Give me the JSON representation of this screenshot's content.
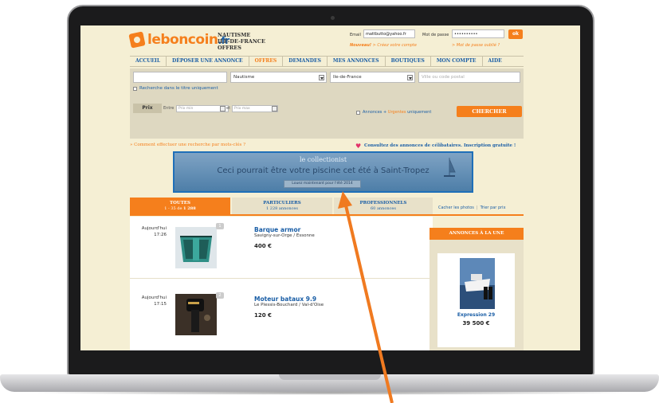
{
  "colors": {
    "brand_orange": "#f57f1c",
    "link_blue": "#1a5ea6",
    "page_bg": "#f5efd4",
    "annotation_arrow": "#f07a20"
  },
  "header": {
    "logo_text": "leboncoin",
    "logo_tld": ".fr",
    "breadcrumb": [
      "NAUTISME",
      "ILE-DE-FRANCE",
      "OFFRES"
    ]
  },
  "login": {
    "email_label": "Email",
    "email_value": "mattbutto@yahoo.fr",
    "password_label": "Mot de passe",
    "password_value": "••••••••••",
    "ok_label": "ok",
    "new_label": "Nouveau!",
    "create_account": "> Créez votre compte",
    "forgot_password": "> Mot de passe oublié ?"
  },
  "nav": {
    "items": [
      "ACCUEIL",
      "DÉPOSER UNE ANNONCE",
      "OFFRES",
      "DEMANDES",
      "MES ANNONCES",
      "BOUTIQUES",
      "MON COMPTE",
      "AIDE"
    ]
  },
  "search": {
    "query_value": "",
    "category_value": "Nautisme",
    "region_value": "Ile-de-France",
    "city_placeholder": "Ville ou code postal",
    "title_only_label": "Recherche dans le titre uniquement",
    "price_label": "Prix",
    "between_label": "Entre",
    "price_min": "Prix min",
    "and_label": "et",
    "price_max": "Prix max",
    "annonces_label": "Annonces",
    "urgentes_label": "Urgentes",
    "uniquement_label": "uniquement",
    "submit_label": "CHERCHER"
  },
  "links": {
    "howto": "» Comment effectuer une recherche par mots-clés ?",
    "celibataires": "Consultez des annonces de célibataires. Inscription gratuite !"
  },
  "banner": {
    "title": "le collectionist",
    "headline": "Ceci pourrait être votre piscine cet été à Saint-Tropez",
    "button": "Louez maintenant pour l'été 2014"
  },
  "tabs": [
    {
      "label": "TOUTES",
      "sub_prefix": "1 - 35 de",
      "sub_count": "1 288"
    },
    {
      "label": "PARTICULIERS",
      "sub": "1 228 annonces"
    },
    {
      "label": "PROFESSIONNELS",
      "sub": "60 annonces"
    }
  ],
  "tab_links": {
    "hide_photos": "Cacher les photos",
    "sort_price": "Trier par prix"
  },
  "listings": [
    {
      "date": "Aujourd'hui",
      "time": "17:26",
      "title": "Barque armor",
      "location": "Savigny-sur-Orge / Essonne",
      "price": "400 €",
      "photos": "1"
    },
    {
      "date": "Aujourd'hui",
      "time": "17:15",
      "title": "Moteur bataux 9.9",
      "location": "Le Plessis-Bouchard / Val-d'Oise",
      "price": "120 €",
      "photos": "2"
    }
  ],
  "featured": {
    "header": "ANNONCES À LA UNE",
    "name": "Expression 29",
    "price": "39 500 €"
  }
}
